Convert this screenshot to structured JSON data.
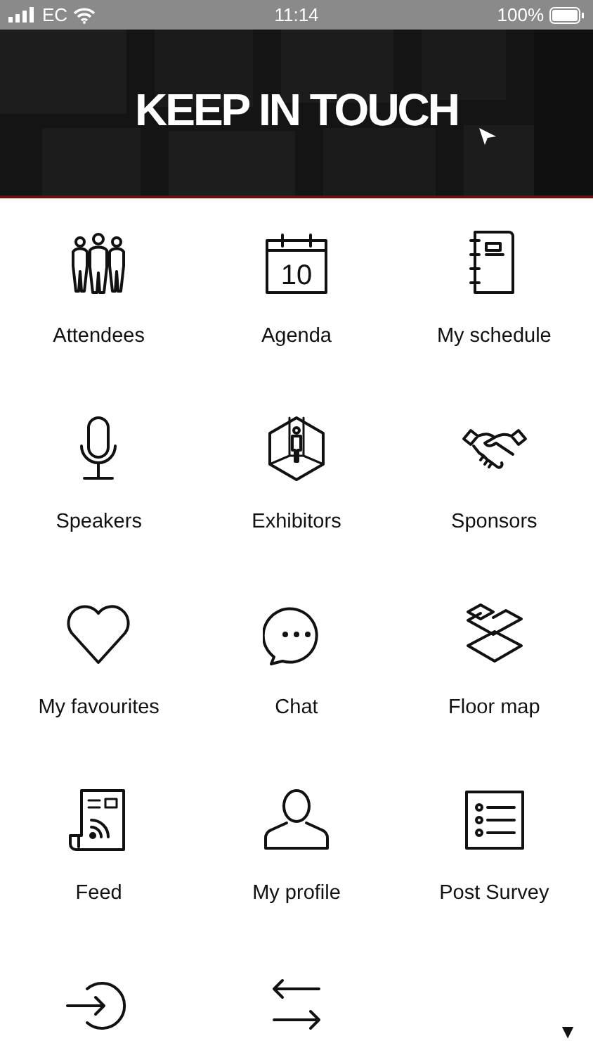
{
  "status_bar": {
    "carrier": "EC",
    "time": "11:14",
    "battery": "100%"
  },
  "banner": {
    "title": "KEEP IN TOUCH"
  },
  "menu": [
    {
      "kind": "attendees",
      "label": "Attendees"
    },
    {
      "kind": "agenda",
      "label": "Agenda"
    },
    {
      "kind": "schedule",
      "label": "My schedule"
    },
    {
      "kind": "speakers",
      "label": "Speakers"
    },
    {
      "kind": "exhibitors",
      "label": "Exhibitors"
    },
    {
      "kind": "sponsors",
      "label": "Sponsors"
    },
    {
      "kind": "favourites",
      "label": "My favourites"
    },
    {
      "kind": "chat",
      "label": "Chat"
    },
    {
      "kind": "floormap",
      "label": "Floor map"
    },
    {
      "kind": "feed",
      "label": "Feed"
    },
    {
      "kind": "profile",
      "label": "My profile"
    },
    {
      "kind": "survey",
      "label": "Post Survey"
    },
    {
      "kind": "login"
    },
    {
      "kind": "switch"
    }
  ],
  "scroll_indicator": "▼",
  "calendar_icon_date": "10"
}
